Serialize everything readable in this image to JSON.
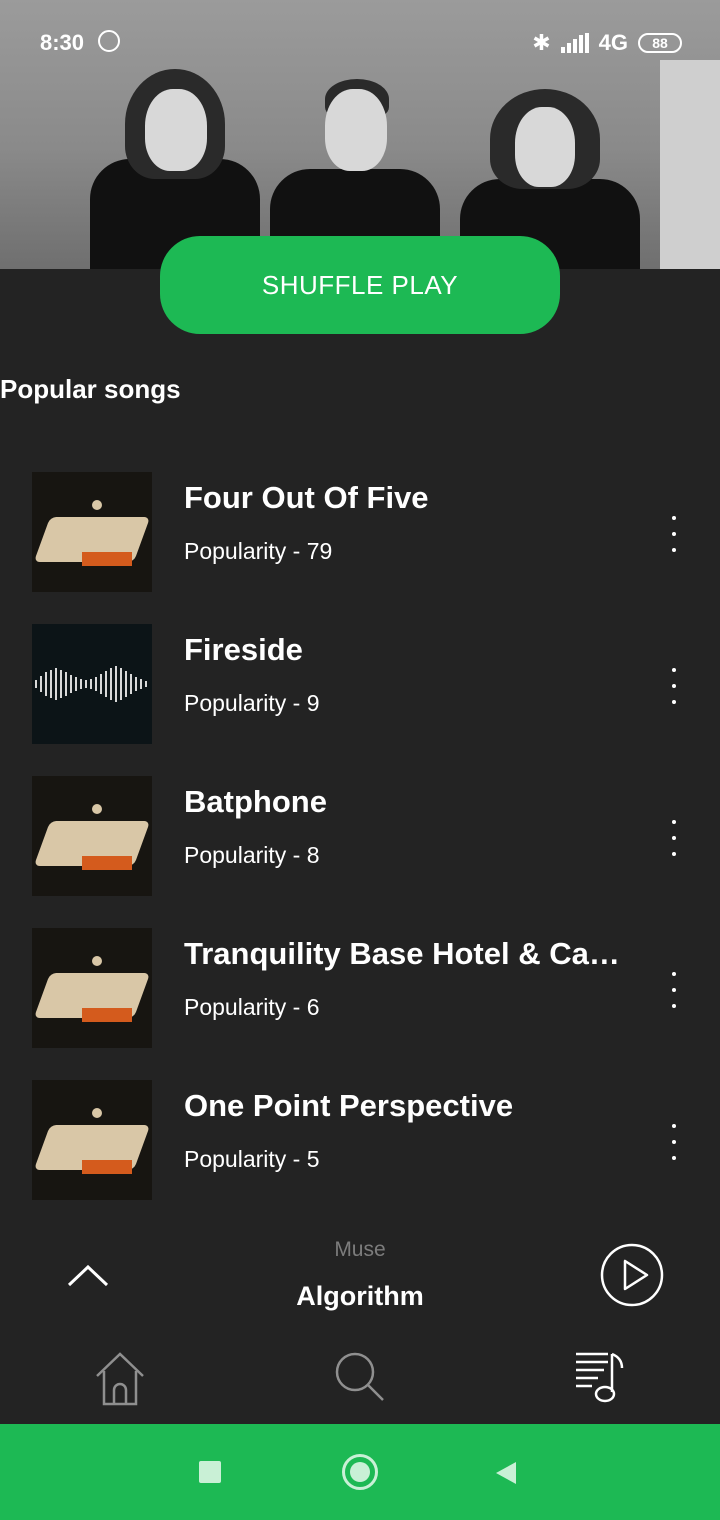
{
  "status_bar": {
    "time": "8:30",
    "network": "4G",
    "battery": "88"
  },
  "actions": {
    "shuffle_label": "SHUFFLE PLAY"
  },
  "section": {
    "title": "Popular songs"
  },
  "songs": [
    {
      "title": "Four Out Of Five",
      "popularity": "Popularity - 79",
      "art": "album-art-hotel"
    },
    {
      "title": "Fireside",
      "popularity": "Popularity - 9",
      "art": "album-art-waves"
    },
    {
      "title": "Batphone",
      "popularity": "Popularity - 8",
      "art": "album-art-hotel"
    },
    {
      "title": "Tranquility Base Hotel & Casino",
      "popularity": "Popularity - 6",
      "art": "album-art-hotel"
    },
    {
      "title": "One Point Perspective",
      "popularity": "Popularity - 5",
      "art": "album-art-hotel"
    }
  ],
  "mini_player": {
    "artist": "Muse",
    "track": "Algorithm"
  },
  "tabs": [
    {
      "name": "home",
      "icon": "home-icon"
    },
    {
      "name": "search",
      "icon": "search-icon"
    },
    {
      "name": "library",
      "icon": "playlist-music-icon"
    }
  ],
  "colors": {
    "accent": "#1db954",
    "background": "#232323"
  }
}
